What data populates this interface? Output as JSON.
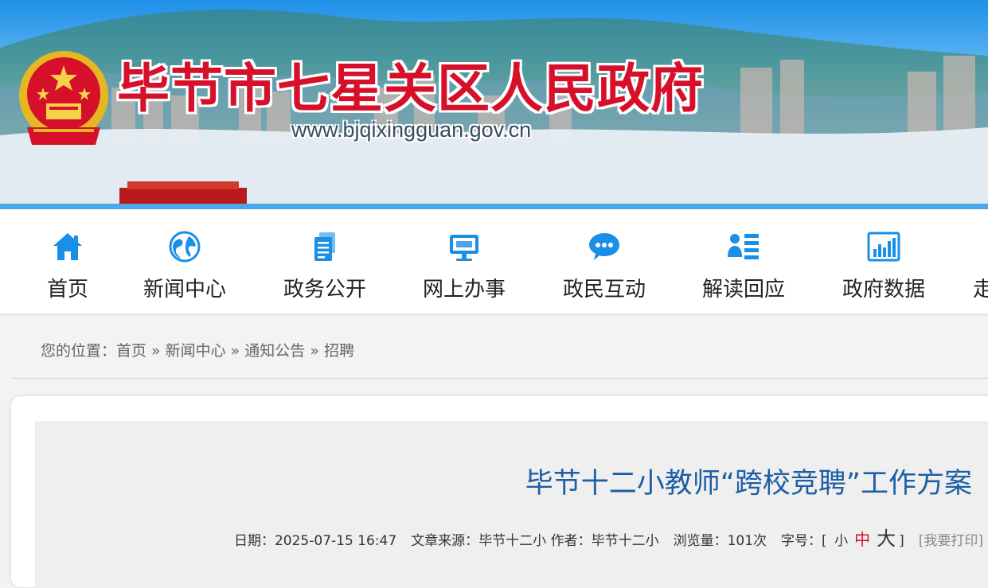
{
  "header": {
    "site_title": "毕节市七星关区人民政府",
    "site_url": "www.bjqixingguan.gov.cn",
    "emblem_icon": "national-emblem-icon"
  },
  "nav": {
    "items": [
      {
        "label": "首页",
        "icon": "home-icon"
      },
      {
        "label": "新闻中心",
        "icon": "globe-icon"
      },
      {
        "label": "政务公开",
        "icon": "document-icon"
      },
      {
        "label": "网上办事",
        "icon": "monitor-icon"
      },
      {
        "label": "政民互动",
        "icon": "chat-bubble-icon"
      },
      {
        "label": "解读回应",
        "icon": "user-list-icon"
      },
      {
        "label": "政府数据",
        "icon": "bar-chart-icon"
      },
      {
        "label": "走"
      }
    ]
  },
  "breadcrumb": {
    "prefix": "您的位置：",
    "items": [
      "首页",
      "新闻中心",
      "通知公告",
      "招聘"
    ],
    "separator": "»"
  },
  "article": {
    "title": "毕节十二小教师“跨校竞聘”工作方案",
    "meta": {
      "date_label": "日期：",
      "date": "2025-07-15 16:47",
      "source_label": "文章来源：",
      "source": "毕节十二小",
      "author_label": "作者：",
      "author": "毕节十二小",
      "views_label": "浏览量：",
      "views": "101次",
      "font_label": "字号：",
      "bracket_open": "[",
      "size_small": "小",
      "size_medium": "中",
      "size_large": "大",
      "bracket_close": "]",
      "print": "[我要打印]"
    }
  },
  "colors": {
    "accent_blue": "#4ca7ec",
    "icon_blue": "#1a8fe6",
    "title_red": "#d6102a",
    "article_title_blue": "#1c5fa5"
  }
}
